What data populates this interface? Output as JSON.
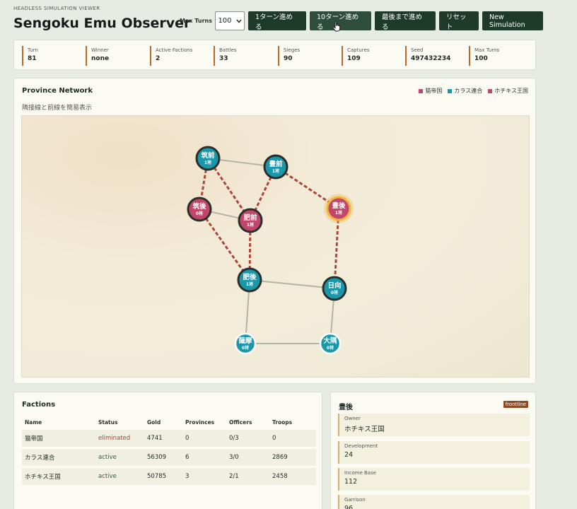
{
  "header": {
    "kicker": "HEADLESS SIMULATION VIEWER",
    "title": "Sengoku Emu Observer",
    "max_turns_label": "Max Turns",
    "max_turns_value": "100",
    "buttons": {
      "step1": "1ターン進める",
      "step10": "10ターン進める",
      "run_to_end": "最後まで進める",
      "reset": "リセット",
      "new_sim": "New Simulation"
    }
  },
  "stats": [
    {
      "label": "Turn",
      "value": "81"
    },
    {
      "label": "Winner",
      "value": "none"
    },
    {
      "label": "Active Factions",
      "value": "2"
    },
    {
      "label": "Battles",
      "value": "33"
    },
    {
      "label": "Sieges",
      "value": "90"
    },
    {
      "label": "Captures",
      "value": "109"
    },
    {
      "label": "Seed",
      "value": "497432234"
    },
    {
      "label": "Max Turns",
      "value": "100"
    }
  ],
  "network": {
    "title": "Province Network",
    "subtitle": "隣接線と前線を簡易表示",
    "legend": [
      {
        "name": "猫帝国",
        "color": "#c2457a"
      },
      {
        "name": "カラス連合",
        "color": "#1a97a8"
      },
      {
        "name": "ホチキス王国",
        "color": "#c2456a"
      }
    ],
    "nodes": [
      {
        "id": "chikuzen",
        "name": "筑前",
        "count": "1将",
        "owner": "teal",
        "ring": "dark"
      },
      {
        "id": "buzen",
        "name": "豊前",
        "count": "1将",
        "owner": "teal",
        "ring": "dark"
      },
      {
        "id": "chikugo",
        "name": "筑後",
        "count": "0将",
        "owner": "red",
        "ring": "dark"
      },
      {
        "id": "hizen",
        "name": "肥前",
        "count": "1将",
        "owner": "red",
        "ring": "dark"
      },
      {
        "id": "bungo",
        "name": "豊後",
        "count": "1将",
        "owner": "red",
        "ring": "gold"
      },
      {
        "id": "higo",
        "name": "肥後",
        "count": "1将",
        "owner": "teal",
        "ring": "dark"
      },
      {
        "id": "hyuga",
        "name": "日向",
        "count": "0将",
        "owner": "teal",
        "ring": "dark"
      },
      {
        "id": "satsuma",
        "name": "薩摩",
        "count": "0将",
        "owner": "teal",
        "ring": "light"
      },
      {
        "id": "osumi",
        "name": "大隅",
        "count": "0将",
        "owner": "teal",
        "ring": "light"
      }
    ],
    "edges": [
      {
        "a": "chikuzen",
        "b": "buzen",
        "front": false
      },
      {
        "a": "chikuzen",
        "b": "chikugo",
        "front": true
      },
      {
        "a": "chikuzen",
        "b": "hizen",
        "front": true
      },
      {
        "a": "buzen",
        "b": "hizen",
        "front": true
      },
      {
        "a": "buzen",
        "b": "bungo",
        "front": true
      },
      {
        "a": "chikugo",
        "b": "hizen",
        "front": false
      },
      {
        "a": "chikugo",
        "b": "higo",
        "front": true
      },
      {
        "a": "hizen",
        "b": "higo",
        "front": true
      },
      {
        "a": "bungo",
        "b": "hyuga",
        "front": true
      },
      {
        "a": "higo",
        "b": "hyuga",
        "front": false
      },
      {
        "a": "higo",
        "b": "satsuma",
        "front": false
      },
      {
        "a": "hyuga",
        "b": "osumi",
        "front": false
      },
      {
        "a": "satsuma",
        "b": "osumi",
        "front": false
      }
    ]
  },
  "factions": {
    "title": "Factions",
    "columns": [
      "Name",
      "Status",
      "Gold",
      "Provinces",
      "Officers",
      "Troops"
    ],
    "rows": [
      {
        "name": "猫帝国",
        "status": "eliminated",
        "gold": "4741",
        "provinces": "0",
        "officers": "0/3",
        "troops": "0"
      },
      {
        "name": "カラス連合",
        "status": "active",
        "gold": "56309",
        "provinces": "6",
        "officers": "3/0",
        "troops": "2869"
      },
      {
        "name": "ホチキス王国",
        "status": "active",
        "gold": "50785",
        "provinces": "3",
        "officers": "2/1",
        "troops": "2458"
      }
    ]
  },
  "detail": {
    "title": "豊後",
    "badge": "frontline",
    "fields": [
      {
        "label": "Owner",
        "value": "ホチキス王国"
      },
      {
        "label": "Development",
        "value": "24"
      },
      {
        "label": "Income Base",
        "value": "112"
      },
      {
        "label": "Garrison",
        "value": "96"
      }
    ]
  },
  "colors": {
    "teal": "#1a97a8",
    "red": "#c2456a",
    "gold": "#f2b441",
    "accent": "#1d3a2a"
  }
}
